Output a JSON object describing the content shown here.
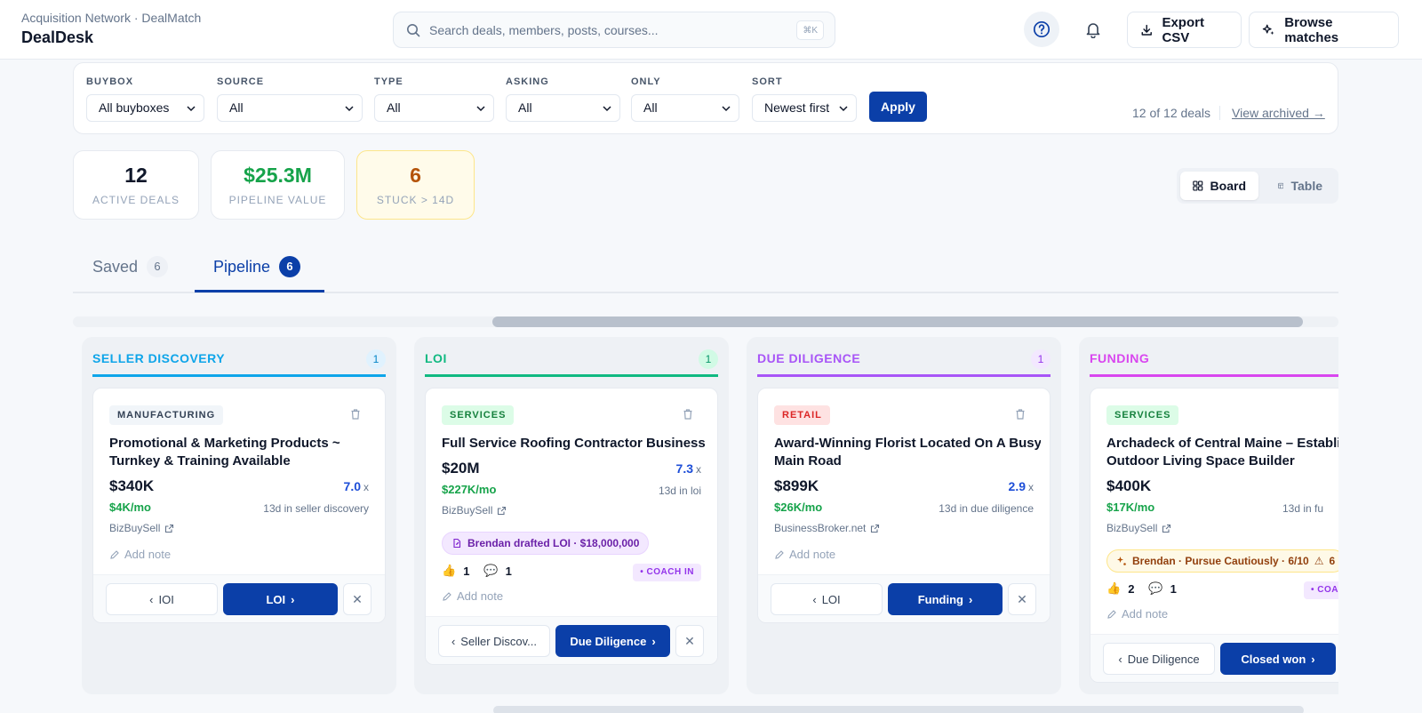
{
  "header": {
    "breadcrumb": "Acquisition Network · DealMatch",
    "title": "DealDesk",
    "search_placeholder": "Search deals, members, posts, courses...",
    "search_shortcut": "⌘K",
    "export_label": "Export CSV",
    "browse_label": "Browse matches"
  },
  "filters": {
    "buybox": {
      "label": "BUYBOX",
      "value": "All buyboxes"
    },
    "source": {
      "label": "SOURCE",
      "value": "All"
    },
    "type": {
      "label": "TYPE",
      "value": "All"
    },
    "asking": {
      "label": "ASKING",
      "value": "All"
    },
    "only": {
      "label": "ONLY",
      "value": "All"
    },
    "sort": {
      "label": "SORT",
      "value": "Newest first"
    },
    "apply_label": "Apply",
    "count_text": "12 of 12 deals",
    "archived_link": "View archived →"
  },
  "stats": [
    {
      "value": "12",
      "label": "ACTIVE DEALS",
      "color": "#0f172a"
    },
    {
      "value": "$25.3M",
      "label": "PIPELINE VALUE",
      "color": "#16a34a"
    },
    {
      "value": "6",
      "label": "STUCK > 14D",
      "color": "#b45309"
    }
  ],
  "view_toggle": {
    "board": "Board",
    "table": "Table",
    "active": "Board"
  },
  "tabs": [
    {
      "label": "Saved",
      "count": "6"
    },
    {
      "label": "Pipeline",
      "count": "6",
      "active": true
    }
  ],
  "columns": [
    {
      "title": "SELLER DISCOVERY",
      "count": "1",
      "color": "#0ea5e9",
      "card": {
        "tag": "MANUFACTURING",
        "title_line1": "Promotional & Marketing Products ~",
        "title_line2": "Turnkey & Training Available",
        "price": "$340K",
        "multiple": "7.0",
        "multiple_unit": "x",
        "monthly": "$4K/mo",
        "days": "13d in seller discovery",
        "source": "BizBuySell",
        "note": "Add note",
        "back_label": "IOI",
        "next_label": "LOI"
      }
    },
    {
      "title": "LOI",
      "count": "1",
      "color": "#10b981",
      "card": {
        "tag": "SERVICES",
        "title_line1": "Full Service Roofing Contractor Business",
        "price": "$20M",
        "multiple": "7.3",
        "multiple_unit": "x",
        "monthly": "$227K/mo",
        "days": "13d in loi",
        "source": "BizBuySell",
        "activity": "Brendan drafted LOI · $18,000,000",
        "likes": "1",
        "comments": "1",
        "coach": "COACH IN",
        "note": "Add note",
        "back_label": "Seller Discov...",
        "next_label": "Due Diligence"
      }
    },
    {
      "title": "DUE DILIGENCE",
      "count": "1",
      "color": "#a855f7",
      "card": {
        "tag": "RETAIL",
        "title_line1": "Award-Winning Florist Located On A Busy",
        "title_line2": "Main Road",
        "price": "$899K",
        "multiple": "2.9",
        "multiple_unit": "x",
        "monthly": "$26K/mo",
        "days": "13d in due diligence",
        "source": "BusinessBroker.net",
        "note": "Add note",
        "back_label": "LOI",
        "next_label": "Funding"
      }
    },
    {
      "title": "FUNDING",
      "count": "1",
      "color": "#d946ef",
      "card": {
        "tag": "SERVICES",
        "title_line1": "Archadeck of Central Maine – Establis",
        "title_line2": "Outdoor Living Space Builder",
        "price": "$400K",
        "multiple": "",
        "multiple_unit": "",
        "monthly": "$17K/mo",
        "days": "13d in fu",
        "source": "BizBuySell",
        "activity": "Brendan · Pursue Cautiously · 6/10",
        "warn_count": "6",
        "likes": "2",
        "comments": "1",
        "coach": "COAC",
        "note": "Add note",
        "back_label": "Due Diligence",
        "next_label": "Closed won"
      }
    }
  ]
}
